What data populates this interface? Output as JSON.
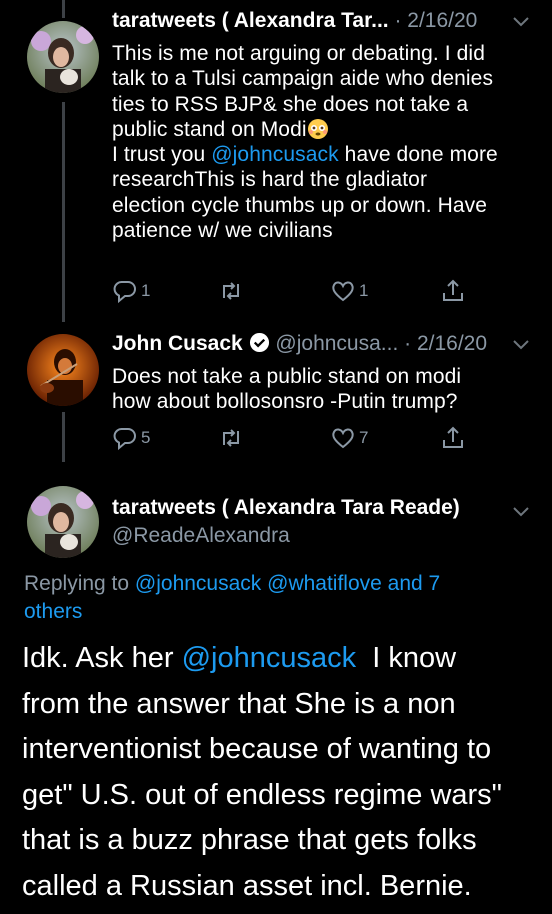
{
  "tweets": [
    {
      "author_name": "taratweets ( Alexandra Tar...",
      "meta": "· 2/16/20",
      "lines": [
        "This is me not arguing or debating. I did",
        "talk to a Tulsi campaign aide who denies",
        "ties to RSS BJP& she does not take a",
        "public stand on Modi",
        "I trust you ",
        "researchThis is hard the gladiator",
        "election cycle thumbs up or down. Have",
        "patience w/ we civilians"
      ],
      "mention": "@johncusack",
      "mention_suffix": " have done more",
      "emoji": "flushed-face",
      "reply_count": "1",
      "retweet_count": "",
      "like_count": "1"
    },
    {
      "author_name": "John Cusack",
      "verified": true,
      "meta": "@johncusa... · 2/16/20",
      "lines": [
        "Does not take a public stand on modi",
        "how about bollosonsro -Putin trump?"
      ],
      "reply_count": "5",
      "retweet_count": "",
      "like_count": "7"
    }
  ],
  "main_tweet": {
    "author_name": "taratweets ( Alexandra Tara Reade)",
    "handle": "@ReadeAlexandra",
    "replying_label": "Replying to ",
    "replying_mentions": "@johncusack @whatiflove and 7",
    "replying_others": "others",
    "first_line_prefix": "Idk. Ask her ",
    "first_line_mention": "@johncusack",
    "first_line_suffix": "  I know",
    "lines": [
      "from the answer that She is a non",
      "interventionist because of wanting to",
      "get\" U.S. out of endless regime wars\"",
      "that is a buzz phrase that gets folks",
      "called a Russian asset incl. Bernie."
    ]
  },
  "colors": {
    "background": "#000000",
    "text": "#ffffff",
    "secondary": "#8b98a5",
    "link": "#1d9bf0",
    "thread_line": "#3d4146"
  },
  "icons": [
    "reply-icon",
    "retweet-icon",
    "like-icon",
    "share-icon",
    "chevron-down-icon",
    "verified-badge-icon"
  ]
}
